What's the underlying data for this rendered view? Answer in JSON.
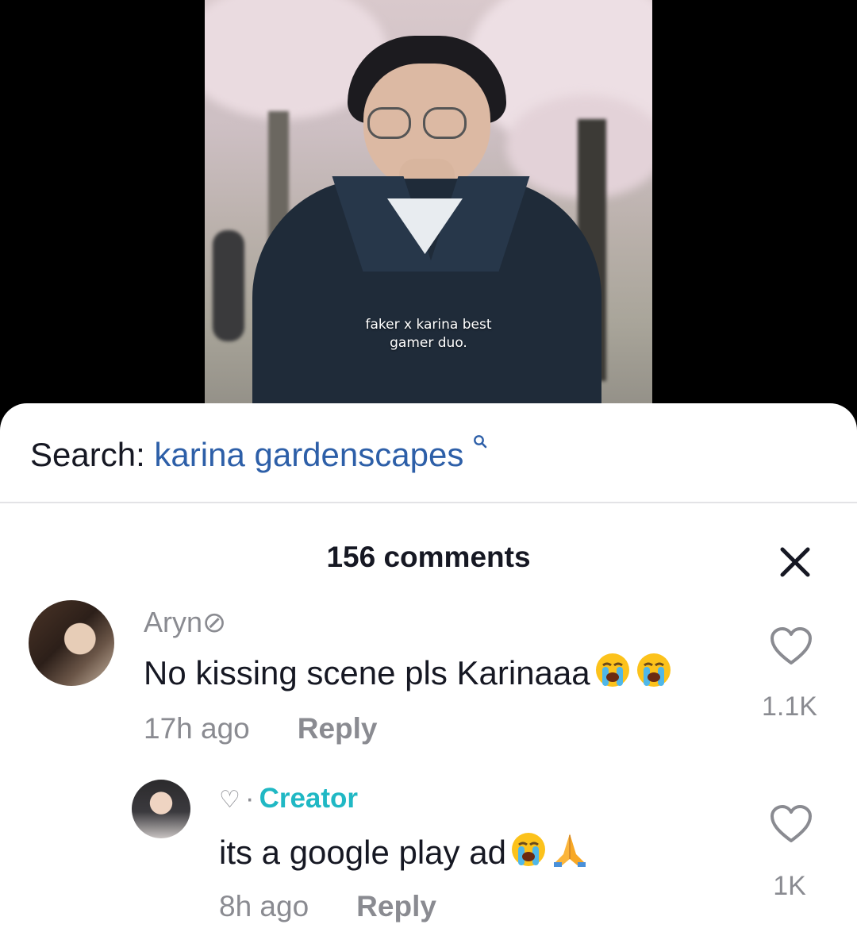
{
  "video": {
    "caption_line1": "faker x karina best",
    "caption_line2": "gamer duo."
  },
  "search": {
    "prefix": "Search:",
    "term": "karina gardenscapes",
    "icon": "search-icon"
  },
  "comments_panel": {
    "title": "156 comments",
    "close_icon": "close-icon",
    "comments": [
      {
        "username": "Aryn⊘",
        "text": "No kissing scene pls Karinaaa",
        "emojis": [
          "loudly-crying-face",
          "loudly-crying-face"
        ],
        "time": "17h ago",
        "reply_label": "Reply",
        "like_count": "1.1K"
      },
      {
        "creator_heart": "♡",
        "separator": "·",
        "creator_label": "Creator",
        "text": "its a google play ad",
        "emojis": [
          "loudly-crying-face",
          "folded-hands"
        ],
        "time": "8h ago",
        "reply_label": "Reply",
        "like_count": "1K"
      }
    ]
  },
  "colors": {
    "link_blue": "#2d5fa8",
    "creator_teal": "#20b8c4",
    "muted_gray": "#8a8b91",
    "text_dark": "#161823"
  }
}
